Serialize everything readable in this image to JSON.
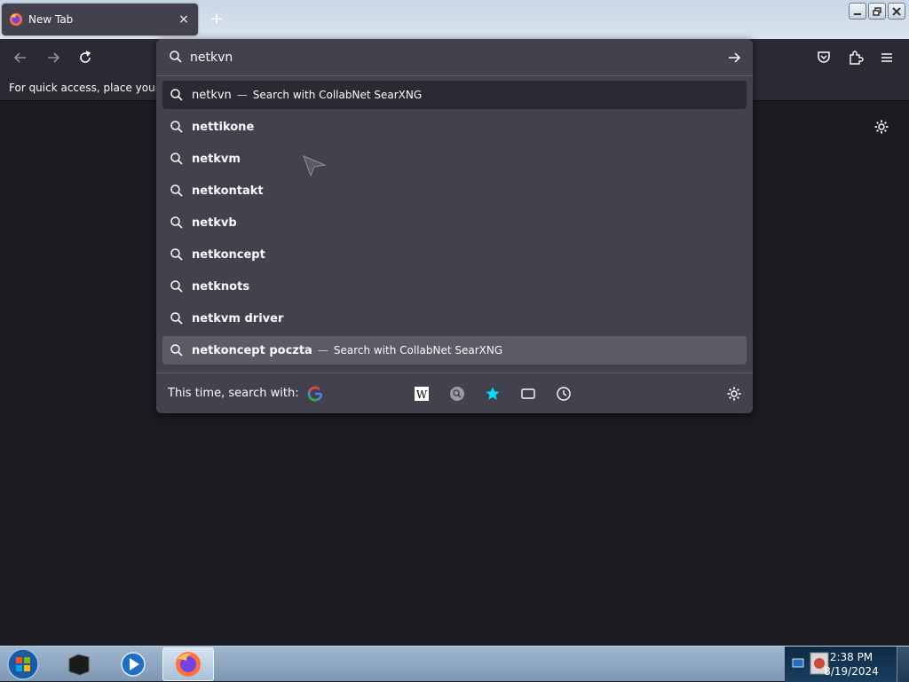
{
  "tab": {
    "title": "New Tab",
    "close_glyph": "×",
    "favicon": "firefox-icon"
  },
  "newtab_glyph": "+",
  "window_controls": [
    "minimize",
    "restore",
    "close"
  ],
  "bookmarks_bar": {
    "text": "For quick access, place your bookmarks here on the bookmarks toolbar."
  },
  "urlbar": {
    "value": "netkvn",
    "results": [
      {
        "text": "netkvn",
        "action": "Search with CollabNet SearXNG",
        "sep": "—"
      },
      {
        "text": "nettikone"
      },
      {
        "text": "netkvm"
      },
      {
        "text": "netkontakt"
      },
      {
        "text": "netkvb"
      },
      {
        "text": "netkoncept"
      },
      {
        "text": "netknots"
      },
      {
        "text": "netkvm driver"
      },
      {
        "text": "netkoncept poczta",
        "action": "Search with CollabNet SearXNG",
        "sep": "—"
      }
    ],
    "search_with_label": "This time, search with:",
    "engines": [
      "google-icon",
      "wikipedia-icon",
      "searxng-icon",
      "bookmarks-star-icon",
      "tabs-icon",
      "history-icon"
    ]
  },
  "taskbar": {
    "clock_time": "2:38 PM",
    "clock_date": "8/19/2024"
  },
  "colors": {
    "accent": "#00ddff",
    "popup_bg": "#42414d",
    "selected_bg": "#5b5a66",
    "page_bg": "#1c1b22"
  }
}
